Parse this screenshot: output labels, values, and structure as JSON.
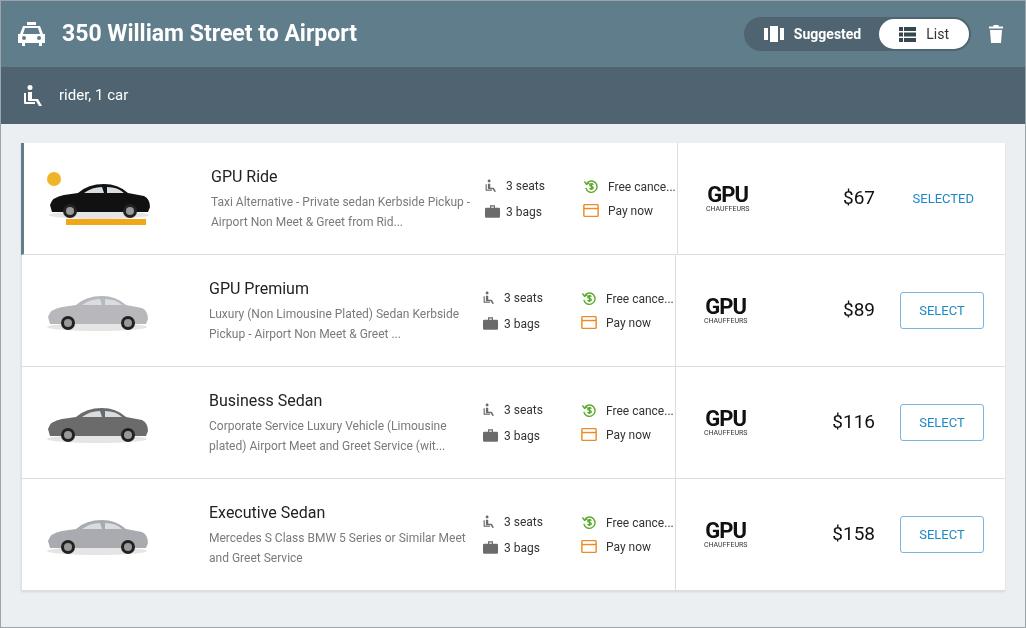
{
  "header": {
    "title": "350 William Street to Airport",
    "view_toggle": [
      {
        "label": "Suggested",
        "kind": "suggested",
        "selected": false
      },
      {
        "label": "List",
        "kind": "list",
        "selected": true
      }
    ]
  },
  "subheader": {
    "text": "rider, 1 car"
  },
  "options": [
    {
      "name": "GPU Ride",
      "description": "Taxi Alternative - Private sedan Kerbside Pickup - Airport Non Meet & Greet from Rid...",
      "seats": "3 seats",
      "bags": "3 bags",
      "cancellation": "Free cance...",
      "payment": "Pay now",
      "provider": "GPU",
      "provider_sub": "CHAUFFEURS",
      "price": "$67",
      "action": "SELECTED",
      "selected": true
    },
    {
      "name": "GPU Premium",
      "description": "Luxury (Non Limousine Plated) Sedan Kerbside Pickup - Airport Non Meet & Greet ...",
      "seats": "3 seats",
      "bags": "3 bags",
      "cancellation": "Free cance...",
      "payment": "Pay now",
      "provider": "GPU",
      "provider_sub": "CHAUFFEURS",
      "price": "$89",
      "action": "SELECT",
      "selected": false
    },
    {
      "name": "Business Sedan",
      "description": "Corporate Service Luxury Vehicle (Limousine plated) Airport Meet and Greet Service (wit...",
      "seats": "3 seats",
      "bags": "3 bags",
      "cancellation": "Free cance...",
      "payment": "Pay now",
      "provider": "GPU",
      "provider_sub": "CHAUFFEURS",
      "price": "$116",
      "action": "SELECT",
      "selected": false
    },
    {
      "name": "Executive Sedan",
      "description": "Mercedes S Class BMW 5 Series or Similar Meet and Greet Service",
      "seats": "3 seats",
      "bags": "3 bags",
      "cancellation": "Free cance...",
      "payment": "Pay now",
      "provider": "GPU",
      "provider_sub": "CHAUFFEURS",
      "price": "$158",
      "action": "SELECT",
      "selected": false
    }
  ]
}
